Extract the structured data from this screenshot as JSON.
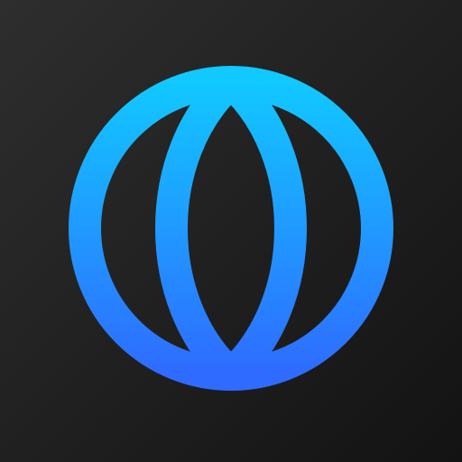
{
  "icon": {
    "name": "globe-icon",
    "accent_top": "#11c8ff",
    "accent_bottom": "#2f6bff",
    "background_light": "#2e2e2e",
    "background_dark": "#131313"
  }
}
